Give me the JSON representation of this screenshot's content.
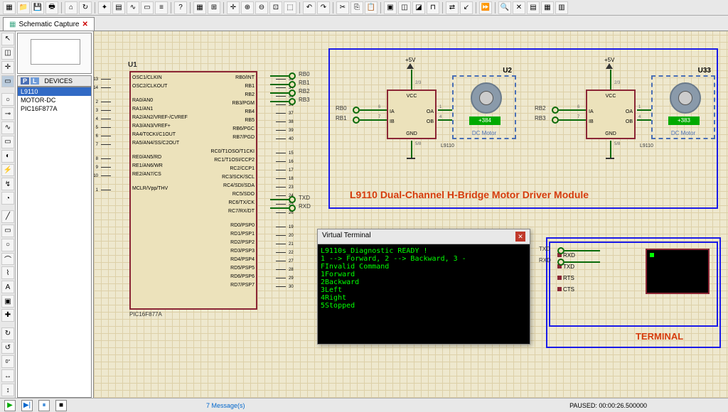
{
  "tab": {
    "name": "Schematic Capture"
  },
  "devices": {
    "header": "DEVICES",
    "p": "P",
    "l": "L",
    "items": [
      "L9110",
      "MOTOR-DC",
      "PIC16F877A"
    ]
  },
  "mcu": {
    "ref": "U1",
    "part": "PIC16F877A",
    "left_pins": [
      {
        "n": "13",
        "l": "OSC1/CLKIN"
      },
      {
        "n": "14",
        "l": "OSC2/CLKOUT"
      },
      {
        "n": "2",
        "l": "RA0/AN0"
      },
      {
        "n": "3",
        "l": "RA1/AN1"
      },
      {
        "n": "4",
        "l": "RA2/AN2/VREF-/CVREF"
      },
      {
        "n": "5",
        "l": "RA3/AN3/VREF+"
      },
      {
        "n": "6",
        "l": "RA4/T0CKI/C1OUT"
      },
      {
        "n": "7",
        "l": "RA5/AN4/SS/C2OUT"
      },
      {
        "n": "8",
        "l": "RE0/AN5/RD"
      },
      {
        "n": "9",
        "l": "RE1/AN6/WR"
      },
      {
        "n": "10",
        "l": "RE2/AN7/CS"
      },
      {
        "n": "1",
        "l": "MCLR/Vpp/THV"
      }
    ],
    "right_pins": [
      {
        "n": "33",
        "l": "RB0/INT"
      },
      {
        "n": "34",
        "l": "RB1"
      },
      {
        "n": "35",
        "l": "RB2"
      },
      {
        "n": "36",
        "l": "RB3/PGM"
      },
      {
        "n": "37",
        "l": "RB4"
      },
      {
        "n": "38",
        "l": "RB5"
      },
      {
        "n": "39",
        "l": "RB6/PGC"
      },
      {
        "n": "40",
        "l": "RB7/PGD"
      },
      {
        "n": "15",
        "l": "RC0/T1OSO/T1CKI"
      },
      {
        "n": "16",
        "l": "RC1/T1OSI/CCP2"
      },
      {
        "n": "17",
        "l": "RC2/CCP1"
      },
      {
        "n": "18",
        "l": "RC3/SCK/SCL"
      },
      {
        "n": "23",
        "l": "RC4/SDI/SDA"
      },
      {
        "n": "24",
        "l": "RC5/SDO"
      },
      {
        "n": "25",
        "l": "RC6/TX/CK"
      },
      {
        "n": "26",
        "l": "RC7/RX/DT"
      },
      {
        "n": "19",
        "l": "RD0/PSP0"
      },
      {
        "n": "20",
        "l": "RD1/PSP1"
      },
      {
        "n": "21",
        "l": "RD2/PSP2"
      },
      {
        "n": "22",
        "l": "RD3/PSP3"
      },
      {
        "n": "27",
        "l": "RD4/PSP4"
      },
      {
        "n": "28",
        "l": "RD5/PSP5"
      },
      {
        "n": "29",
        "l": "RD6/PSP6"
      },
      {
        "n": "30",
        "l": "RD7/PSP7"
      }
    ],
    "rb_nets": [
      "RB0",
      "RB1",
      "RB2",
      "RB3"
    ],
    "tx_net": "TXD",
    "rx_net": "RXD"
  },
  "module": {
    "title": "L9110 Dual-Channel H-Bridge Motor Driver Module",
    "v5": "+5V",
    "driver1": {
      "part": "L9110",
      "vcc": "VCC",
      "gnd": "GND",
      "ia": "IA",
      "ib": "IB",
      "oa": "OA",
      "ob": "OB",
      "p_ia": "6",
      "p_ib": "7",
      "p_oa": "1",
      "p_ob": "4",
      "p_vcc": "2/3",
      "p_gnd": "5/8",
      "net_a": "RB0",
      "net_b": "RB1"
    },
    "driver2": {
      "part": "L9110",
      "vcc": "VCC",
      "gnd": "GND",
      "ia": "IA",
      "ib": "IB",
      "oa": "OA",
      "ob": "OB",
      "p_ia": "6",
      "p_ib": "7",
      "p_oa": "1",
      "p_ob": "4",
      "p_vcc": "2/3",
      "p_gnd": "5/8",
      "net_a": "RB2",
      "net_b": "RB3"
    },
    "motor1": {
      "ref": "U2",
      "status": "+384",
      "caption": "DC Motor"
    },
    "motor2": {
      "ref": "U33",
      "status": "+383",
      "caption": "DC Motor"
    }
  },
  "vterm": {
    "title": "Virtual Terminal",
    "lines": [
      "L9110s_Diagnostic READY !",
      "1 --> Forward, 2 --> Backward, 3 -",
      "FInvalid Command",
      "1Forward",
      "2Backward",
      "3Left",
      "4Right",
      "5Stopped"
    ]
  },
  "terminal": {
    "title": "TERMINAL",
    "pins": [
      "RXD",
      "TXD",
      "RTS",
      "CTS"
    ],
    "nets": [
      "TXD",
      "RXD"
    ]
  },
  "status": {
    "messages": "7 Message(s)",
    "paused": "PAUSED: 00:00:26.500000"
  }
}
